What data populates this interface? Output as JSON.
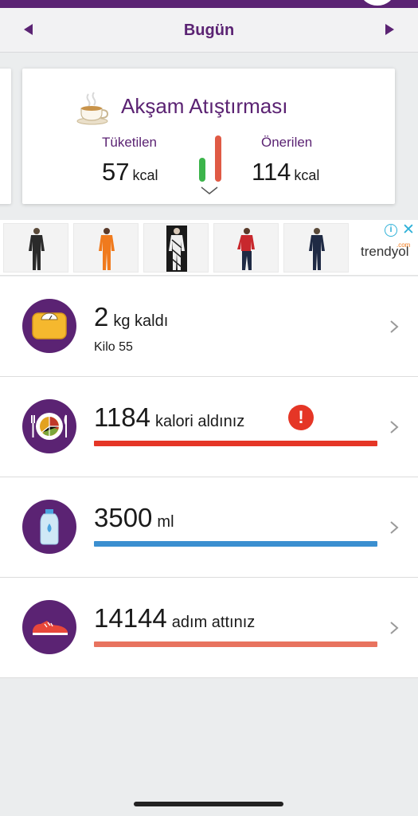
{
  "header": {
    "date_label": "Bugün"
  },
  "meal_card": {
    "title": "Akşam Atıştırması",
    "consumed_label": "Tüketilen",
    "consumed_value": "57",
    "recommended_label": "Önerilen",
    "recommended_value": "114",
    "unit": "kcal",
    "icon": "tea-cup-icon",
    "bar_colors": {
      "consumed": "#3cb44b",
      "recommended": "#e05a45"
    }
  },
  "ad": {
    "brand": "trendyol",
    "brand_badge": ".com",
    "info_glyph": "i",
    "close_glyph": "✕",
    "thumbnails": [
      {
        "icon": "tracksuit-black-product-icon",
        "color": "#2a2a2a"
      },
      {
        "icon": "tracksuit-orange-product-icon",
        "color": "#f07a1d"
      },
      {
        "icon": "tracksuit-patterned-product-icon",
        "color": "#1a1a1a"
      },
      {
        "icon": "tracksuit-red-product-icon",
        "color": "#c8282d"
      },
      {
        "icon": "tracksuit-navy-product-icon",
        "color": "#1f2a44"
      }
    ]
  },
  "trackers": {
    "weight": {
      "value": "2",
      "suffix": "kg kaldı",
      "sub": "Kilo 55",
      "icon": "scale-icon"
    },
    "calories": {
      "value": "1184",
      "suffix": "kalori aldınız",
      "alert_glyph": "!",
      "bar_color": "#e53626",
      "icon": "plate-icon"
    },
    "water": {
      "value": "3500",
      "suffix": "ml",
      "bar_color": "#3b8fd0",
      "icon": "water-bottle-icon"
    },
    "steps": {
      "value": "14144",
      "suffix": "adım attınız",
      "bar_color": "#e8735f",
      "icon": "sneaker-icon"
    }
  },
  "theme": {
    "primary": "#5b2373",
    "accent_blue": "#2fb1d8"
  }
}
